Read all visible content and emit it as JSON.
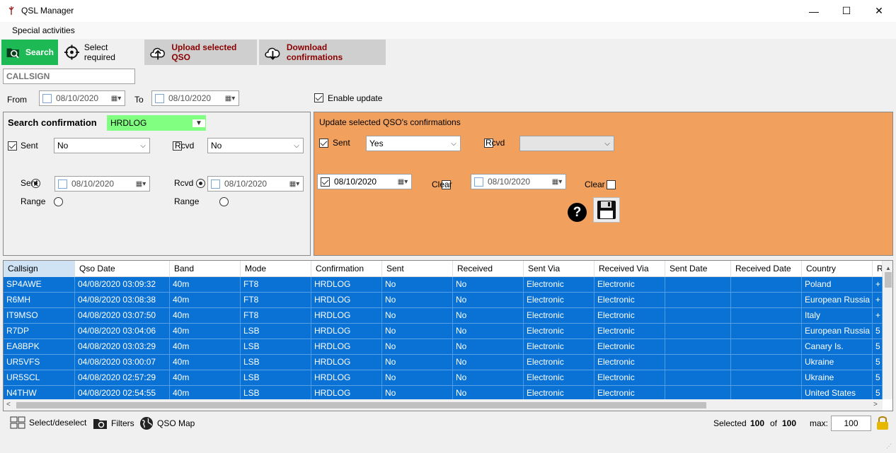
{
  "window": {
    "title": "QSL Manager",
    "controls": {
      "minimize": "—",
      "maximize": "☐",
      "close": "✕"
    }
  },
  "menu": {
    "special_activities": "Special activities"
  },
  "toolbar": {
    "search": "Search",
    "select_required": "Select required",
    "upload": "Upload selected QSO",
    "download": "Download confirmations"
  },
  "callsign": {
    "placeholder": "CALLSIGN"
  },
  "range": {
    "from_label": "From",
    "from_date": "08/10/2020",
    "to_label": "To",
    "to_date": "08/10/2020",
    "enable_update_label": "Enable update"
  },
  "search_panel": {
    "title": "Search confirmation",
    "service": "HRDLOG",
    "sent_label": "Sent",
    "sent_value": "No",
    "rcvd_label": "Rcvd",
    "rcvd_value": "No",
    "sent_radio_label": "Sent",
    "sent_date": "08/10/2020",
    "rcvd_radio_label": "Rcvd",
    "rcvd_date": "08/10/2020",
    "range_label_1": "Range",
    "range_label_2": "Range"
  },
  "update_panel": {
    "title": "Update selected QSO's confirmations",
    "sent_label": "Sent",
    "sent_value": "Yes",
    "rcvd_label": "Rcvd",
    "rcvd_value": "",
    "sent_date": "08/10/2020",
    "clear_label_1": "Clear",
    "rcvd_date": "08/10/2020",
    "clear_label_2": "Clear",
    "help_glyph": "?"
  },
  "grid": {
    "columns": [
      "Callsign",
      "Qso Date",
      "Band",
      "Mode",
      "Confirmation",
      "Sent",
      "Received",
      "Sent Via",
      "Received Via",
      "Sent Date",
      "Received Date",
      "Country",
      "R"
    ],
    "rows": [
      [
        "SP4AWE",
        "04/08/2020 03:09:32",
        "40m",
        "FT8",
        "HRDLOG",
        "No",
        "No",
        "Electronic",
        "Electronic",
        "",
        "",
        "Poland",
        "+"
      ],
      [
        "R6MH",
        "04/08/2020 03:08:38",
        "40m",
        "FT8",
        "HRDLOG",
        "No",
        "No",
        "Electronic",
        "Electronic",
        "",
        "",
        "European Russia",
        "+"
      ],
      [
        "IT9MSO",
        "04/08/2020 03:07:50",
        "40m",
        "FT8",
        "HRDLOG",
        "No",
        "No",
        "Electronic",
        "Electronic",
        "",
        "",
        "Italy",
        "+"
      ],
      [
        "R7DP",
        "04/08/2020 03:04:06",
        "40m",
        "LSB",
        "HRDLOG",
        "No",
        "No",
        "Electronic",
        "Electronic",
        "",
        "",
        "European Russia",
        "5"
      ],
      [
        "EA8BPK",
        "04/08/2020 03:03:29",
        "40m",
        "LSB",
        "HRDLOG",
        "No",
        "No",
        "Electronic",
        "Electronic",
        "",
        "",
        "Canary Is.",
        "5"
      ],
      [
        "UR5VFS",
        "04/08/2020 03:00:07",
        "40m",
        "LSB",
        "HRDLOG",
        "No",
        "No",
        "Electronic",
        "Electronic",
        "",
        "",
        "Ukraine",
        "5"
      ],
      [
        "UR5SCL",
        "04/08/2020 02:57:29",
        "40m",
        "LSB",
        "HRDLOG",
        "No",
        "No",
        "Electronic",
        "Electronic",
        "",
        "",
        "Ukraine",
        "5"
      ],
      [
        "N4THW",
        "04/08/2020 02:54:55",
        "40m",
        "LSB",
        "HRDLOG",
        "No",
        "No",
        "Electronic",
        "Electronic",
        "",
        "",
        "United States",
        "5"
      ]
    ]
  },
  "status": {
    "select_deselect": "Select/deselect",
    "filters": "Filters",
    "qso_map": "QSO Map",
    "selected_label": "Selected",
    "selected_count": "100",
    "of_label": "of",
    "total_count": "100",
    "max_label": "max:",
    "max_value": "100"
  },
  "colors": {
    "search_button": "#1db954",
    "update_panel": "#f2a05e",
    "service_combo": "#80ff80",
    "selection": "#0a72d4",
    "toolbar_button": "#cfcfcf",
    "emphasis_text": "#8b0000"
  },
  "icons": [
    "app-icon",
    "folder-search-icon",
    "crosshair-icon",
    "cloud-upload-icon",
    "cloud-download-icon",
    "help-icon",
    "save-disk-icon",
    "grid-select-icon",
    "folder-filter-icon",
    "globe-icon",
    "lock-icon",
    "calendar-icon",
    "chevron-down-icon"
  ]
}
